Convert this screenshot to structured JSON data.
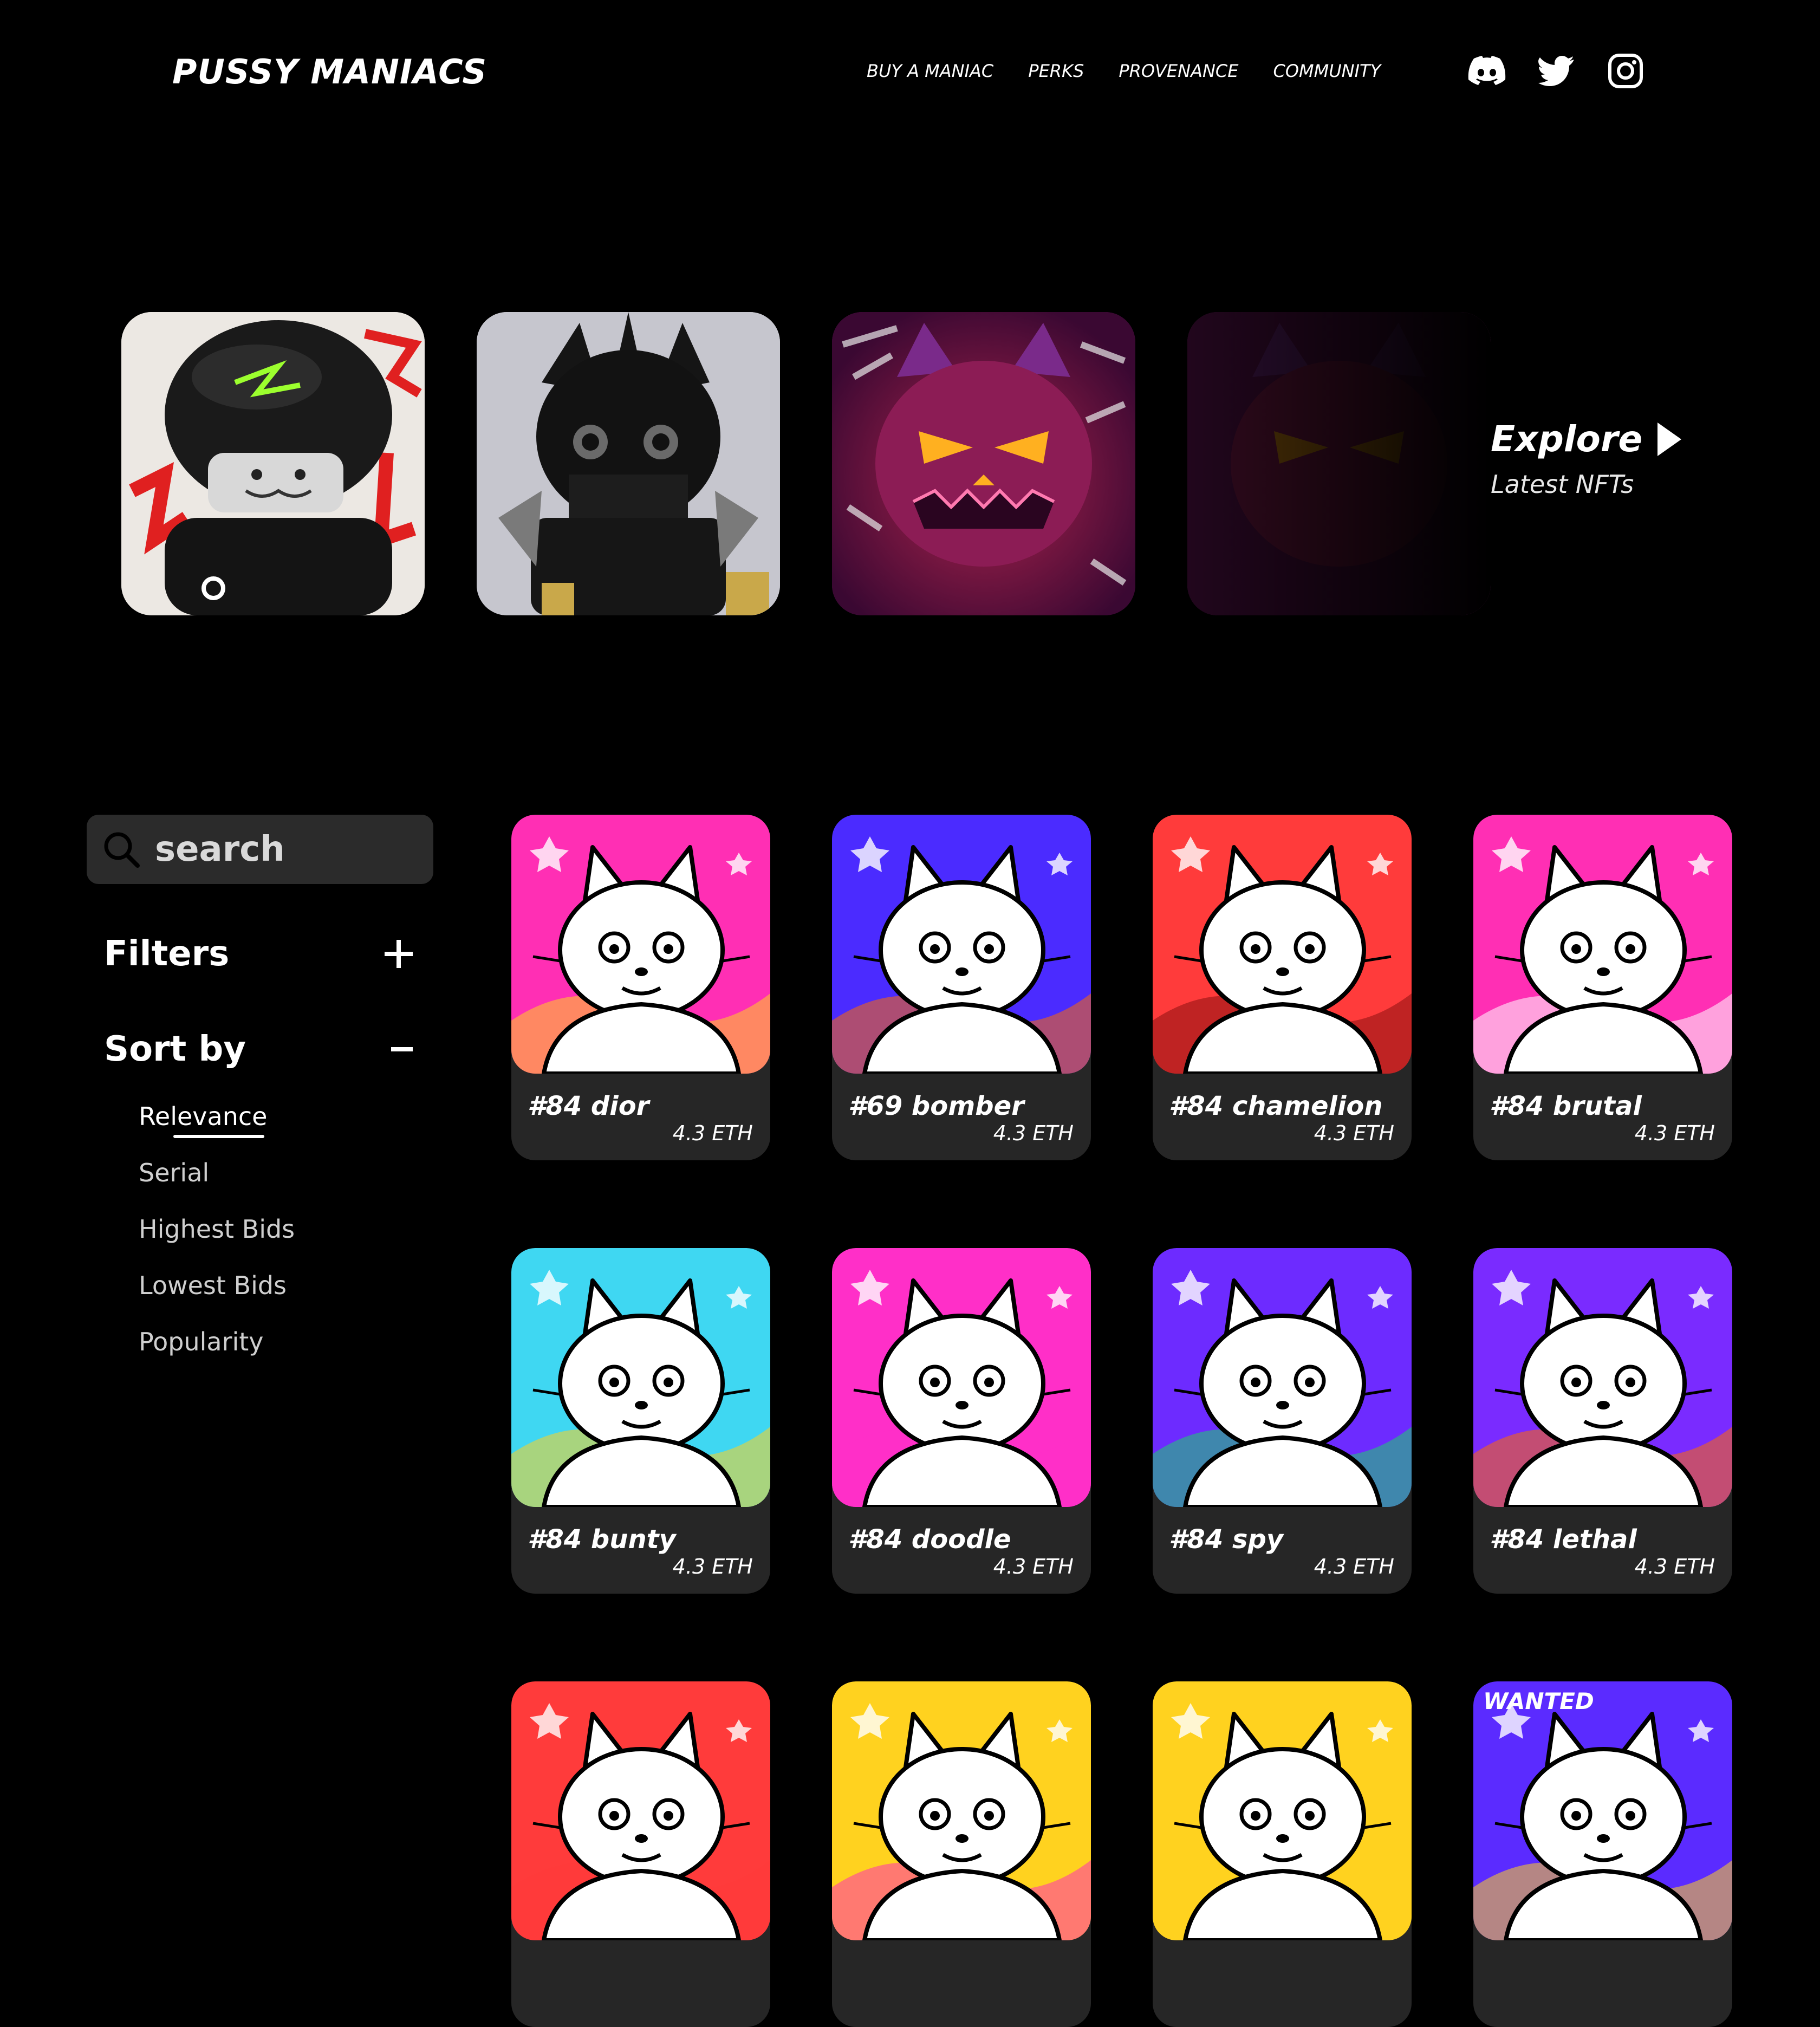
{
  "header": {
    "logo": "PUSSY MANIACS",
    "nav": [
      "BUY A MANIAC",
      "PERKS",
      "PROVENANCE",
      "COMMUNITY"
    ],
    "social_icons": [
      "discord-icon",
      "twitter-icon",
      "instagram-icon"
    ]
  },
  "carousel": {
    "cards": [
      {
        "name": "robocat-helmet-nft",
        "bg": "#e9e6e2"
      },
      {
        "name": "black-knight-cat-nft",
        "bg": "#bfbfc6"
      },
      {
        "name": "pumpkin-cat-nft",
        "bg": "#5b1255"
      },
      {
        "name": "pumpkin-cat-faded-nft",
        "bg": "#2a0a26"
      }
    ],
    "explore_title": "Explore",
    "explore_subtitle": "Latest NFTs"
  },
  "sidebar": {
    "search_placeholder": "search",
    "filters_label": "Filters",
    "sort_label": "Sort by",
    "sort_options": [
      "Relevance",
      "Serial",
      "Highest Bids",
      "Lowest Bids",
      "Popularity"
    ],
    "active_sort": "Relevance"
  },
  "grid": {
    "items": [
      {
        "name": "#84 dior",
        "price": "4.3 ETH",
        "bg": "#ff2fb4",
        "accent": "#ffd21f"
      },
      {
        "name": "#69 bomber",
        "price": "4.3 ETH",
        "bg": "#4b2bff",
        "accent": "#ff6a00"
      },
      {
        "name": "#84 chamelion",
        "price": "4.3 ETH",
        "bg": "#ff3b3b",
        "accent": "#8a1010"
      },
      {
        "name": "#84 brutal",
        "price": "4.3 ETH",
        "bg": "#ff2fb4",
        "accent": "#ffffff"
      },
      {
        "name": "#84 bunty",
        "price": "4.3 ETH",
        "bg": "#3fd7f2",
        "accent": "#ffd21f"
      },
      {
        "name": "#84 doodle",
        "price": "4.3 ETH",
        "bg": "#ff2fc8",
        "accent": "#ff2fc8"
      },
      {
        "name": "#84 spy",
        "price": "4.3 ETH",
        "bg": "#6d2bff",
        "accent": "#19d36a"
      },
      {
        "name": "#84 lethal",
        "price": "4.3 ETH",
        "bg": "#7a2bff",
        "accent": "#ff6a00"
      },
      {
        "name": "",
        "price": "",
        "bg": "#ff3b3b",
        "accent": "#ff3b3b"
      },
      {
        "name": "",
        "price": "",
        "bg": "#ffd21f",
        "accent": "#ff2fb4"
      },
      {
        "name": "",
        "price": "",
        "bg": "#ffd21f",
        "accent": "#ffd21f"
      },
      {
        "name": "",
        "price": "",
        "bg": "#5b2bff",
        "accent": "#ffd21f"
      }
    ],
    "wanted_label": "WANTED"
  }
}
